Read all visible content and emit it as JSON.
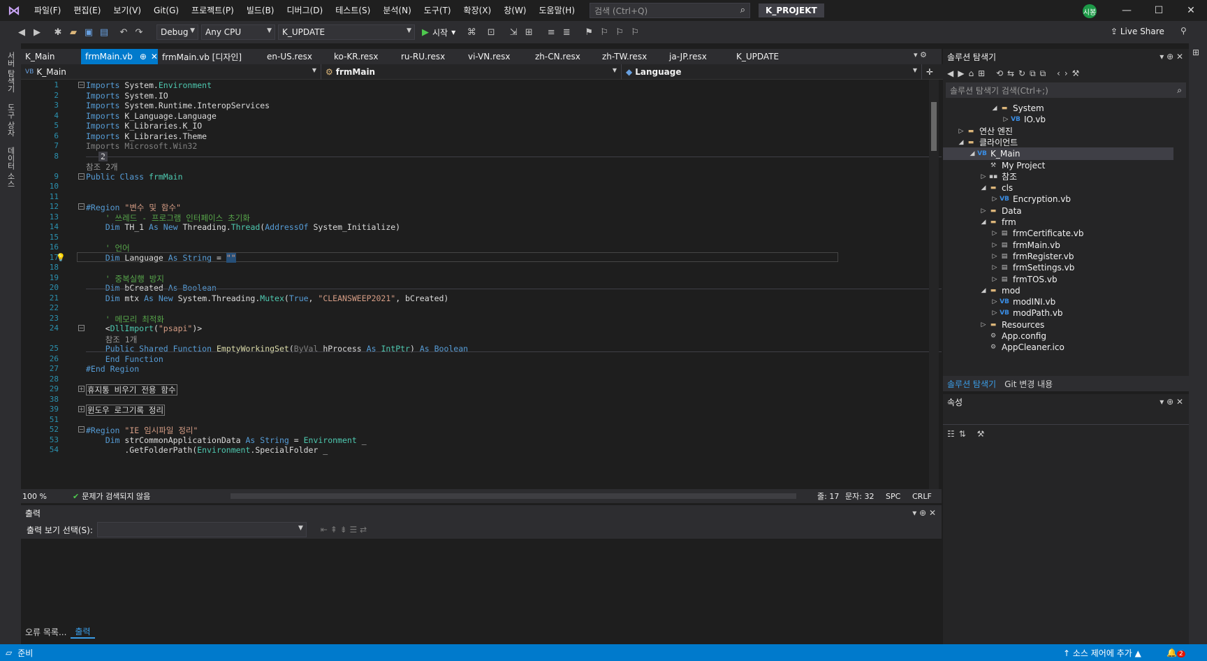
{
  "menu": {
    "items": [
      "파일(F)",
      "편집(E)",
      "보기(V)",
      "Git(G)",
      "프로젝트(P)",
      "빌드(B)",
      "디버그(D)",
      "테스트(S)",
      "분석(N)",
      "도구(T)",
      "확장(X)",
      "창(W)",
      "도움말(H)"
    ],
    "search_placeholder": "검색 (Ctrl+Q)",
    "project_name": "K_PROJEKT",
    "avatar": "시봉"
  },
  "toolbar": {
    "config": "Debug",
    "platform": "Any CPU",
    "startup_project": "K_UPDATE",
    "start_label": "시작",
    "live_share": "Live Share"
  },
  "left_strip": {
    "tabs": [
      "서버 탐색기",
      "도구 상자",
      "데이터 소스"
    ]
  },
  "tabs": [
    {
      "label": "K_Main"
    },
    {
      "label": "frmMain.vb",
      "active": true,
      "pin": "⊕",
      "close": "✕"
    },
    {
      "label": "frmMain.vb [디자인]"
    },
    {
      "label": "en-US.resx"
    },
    {
      "label": "ko-KR.resx"
    },
    {
      "label": "ru-RU.resx"
    },
    {
      "label": "vi-VN.resx"
    },
    {
      "label": "zh-CN.resx"
    },
    {
      "label": "zh-TW.resx"
    },
    {
      "label": "ja-JP.resx"
    },
    {
      "label": "K_UPDATE"
    }
  ],
  "navbar": {
    "project": "K_Main",
    "class": "frmMain",
    "member": "Language"
  },
  "editor": {
    "lines": [
      {
        "n": "1",
        "html": "<span class='kw'>Imports</span> System.<span class='ty'>Environment</span>",
        "fold": "-"
      },
      {
        "n": "2",
        "html": "<span class='kw'>Imports</span> System.IO"
      },
      {
        "n": "3",
        "html": "<span class='kw'>Imports</span> System.Runtime.InteropServices"
      },
      {
        "n": "4",
        "html": "<span class='kw'>Imports</span> K_Language.Language"
      },
      {
        "n": "5",
        "html": "<span class='kw'>Imports</span> K_Libraries.K_IO"
      },
      {
        "n": "6",
        "html": "<span class='kw'>Imports</span> K_Libraries.Theme"
      },
      {
        "n": "7",
        "html": "<span class='gr'>Imports Microsoft.Win32</span>"
      },
      {
        "n": "8",
        "html": "<span style='background:#3f3f46;padding:0 3px;margin-left:18px'>2</span>"
      },
      {
        "n": "",
        "html": "<span class='ref'>참조 2개</span>"
      },
      {
        "n": "9",
        "html": "<span class='kw'>Public Class</span> <span class='ty'>frmMain</span>",
        "fold": "-"
      },
      {
        "n": "10",
        "html": ""
      },
      {
        "n": "11",
        "html": ""
      },
      {
        "n": "12",
        "html": "<span class='kw'>#Region</span> <span class='st'>\"변수 및 함수\"</span>",
        "fold": "-"
      },
      {
        "n": "13",
        "html": "    <span class='cm'>' 쓰레드 - 프로그램 인터페이스 초기화</span>"
      },
      {
        "n": "14",
        "html": "    <span class='kw'>Dim</span> TH_1 <span class='kw'>As New</span> Threading.<span class='ty'>Thread</span>(<span class='kw'>AddressOf</span> System_Initialize)"
      },
      {
        "n": "15",
        "html": ""
      },
      {
        "n": "16",
        "html": "    <span class='cm'>' 언어</span>"
      },
      {
        "n": "17",
        "html": "    <span class='kw'>Dim</span> Language <span class='kw'>As String</span> = <span class='st' style='background:#264f78'>\"\"</span>",
        "bulb": true
      },
      {
        "n": "18",
        "html": ""
      },
      {
        "n": "19",
        "html": "    <span class='cm'>' 중복실행 방지</span>"
      },
      {
        "n": "20",
        "html": "    <span class='kw'>Dim</span> bCreated <span class='kw'>As Boolean</span>"
      },
      {
        "n": "21",
        "html": "    <span class='kw'>Dim</span> mtx <span class='kw'>As New</span> System.Threading.<span class='ty'>Mutex</span>(<span class='kw'>True</span>, <span class='st'>\"CLEANSWEEP2021\"</span>, bCreated)"
      },
      {
        "n": "22",
        "html": ""
      },
      {
        "n": "23",
        "html": "    <span class='cm'>' 메모리 최적화</span>"
      },
      {
        "n": "24",
        "html": "    &lt;<span class='ty'>DllImport</span>(<span class='st'>\"psapi\"</span>)&gt;",
        "fold": "-"
      },
      {
        "n": "",
        "html": "    <span class='ref'>참조 1개</span>"
      },
      {
        "n": "25",
        "html": "    <span class='kw'>Public Shared Function</span> <span class='mt'>EmptyWorkingSet</span>(<span class='gr'>ByVal</span> hProcess <span class='kw'>As</span> <span class='ty'>IntPtr</span>) <span class='kw'>As Boolean</span>"
      },
      {
        "n": "26",
        "html": "    <span class='kw'>End Function</span>"
      },
      {
        "n": "27",
        "html": "<span class='kw'>#End Region</span>"
      },
      {
        "n": "28",
        "html": ""
      },
      {
        "n": "29",
        "html": "<span class='boxed'>휴지통 비우기 전용 함수</span>",
        "fold": "+"
      },
      {
        "n": "38",
        "html": ""
      },
      {
        "n": "39",
        "html": "<span class='boxed'>윈도우 로그기록 정리</span>",
        "fold": "+"
      },
      {
        "n": "51",
        "html": ""
      },
      {
        "n": "52",
        "html": "<span class='kw'>#Region</span> <span class='st'>\"IE 임시파일 정리\"</span>",
        "fold": "-"
      },
      {
        "n": "53",
        "html": "    <span class='kw'>Dim</span> strCommonApplicationData <span class='kw'>As String</span> = <span class='ty'>Environment</span> _"
      },
      {
        "n": "54",
        "html": "        .GetFolderPath(<span class='ty'>Environment</span>.SpecialFolder _"
      }
    ]
  },
  "editor_status": {
    "zoom": "100 %",
    "issues": "문제가 검색되지 않음",
    "line": "줄: 17",
    "col": "문자: 32",
    "spc": "SPC",
    "eol": "CRLF"
  },
  "output": {
    "title": "출력",
    "select_label": "출력 보기 선택(S):",
    "tabs": [
      "오류 목록...",
      "출력"
    ]
  },
  "solution": {
    "title": "솔루션 탐색기",
    "search_placeholder": "솔루션 탐색기 검색(Ctrl+;)",
    "tree": [
      {
        "label": "System",
        "indent": 4,
        "icon": "folder",
        "exp": "◢"
      },
      {
        "label": "IO.vb",
        "indent": 5,
        "icon": "vb",
        "exp": "▷"
      },
      {
        "label": "연산 엔진",
        "indent": 1,
        "icon": "folder",
        "exp": "▷"
      },
      {
        "label": "클라이언트",
        "indent": 1,
        "icon": "folder",
        "exp": "◢"
      },
      {
        "label": "K_Main",
        "indent": 2,
        "icon": "proj",
        "exp": "◢",
        "sel": true
      },
      {
        "label": "My Project",
        "indent": 3,
        "icon": "wrench",
        "exp": ""
      },
      {
        "label": "참조",
        "indent": 3,
        "icon": "ref",
        "exp": "▷"
      },
      {
        "label": "cls",
        "indent": 3,
        "icon": "folder",
        "exp": "◢"
      },
      {
        "label": "Encryption.vb",
        "indent": 4,
        "icon": "vb",
        "exp": "▷"
      },
      {
        "label": "Data",
        "indent": 3,
        "icon": "folder",
        "exp": "▷"
      },
      {
        "label": "frm",
        "indent": 3,
        "icon": "folder",
        "exp": "◢"
      },
      {
        "label": "frmCertificate.vb",
        "indent": 4,
        "icon": "form",
        "exp": "▷"
      },
      {
        "label": "frmMain.vb",
        "indent": 4,
        "icon": "form",
        "exp": "▷"
      },
      {
        "label": "frmRegister.vb",
        "indent": 4,
        "icon": "form",
        "exp": "▷"
      },
      {
        "label": "frmSettings.vb",
        "indent": 4,
        "icon": "form",
        "exp": "▷"
      },
      {
        "label": "frmTOS.vb",
        "indent": 4,
        "icon": "form",
        "exp": "▷"
      },
      {
        "label": "mod",
        "indent": 3,
        "icon": "folder",
        "exp": "◢"
      },
      {
        "label": "modINI.vb",
        "indent": 4,
        "icon": "vb",
        "exp": "▷"
      },
      {
        "label": "modPath.vb",
        "indent": 4,
        "icon": "vb",
        "exp": "▷"
      },
      {
        "label": "Resources",
        "indent": 3,
        "icon": "folder",
        "exp": "▷"
      },
      {
        "label": "App.config",
        "indent": 3,
        "icon": "file",
        "exp": ""
      },
      {
        "label": "AppCleaner.ico",
        "indent": 3,
        "icon": "file",
        "exp": ""
      }
    ],
    "tabs": [
      "솔루션 탐색기",
      "Git 변경 내용"
    ]
  },
  "properties": {
    "title": "속성"
  },
  "statusbar": {
    "ready": "준비",
    "source_control": "소스 제어에 추가",
    "notif": "2"
  }
}
